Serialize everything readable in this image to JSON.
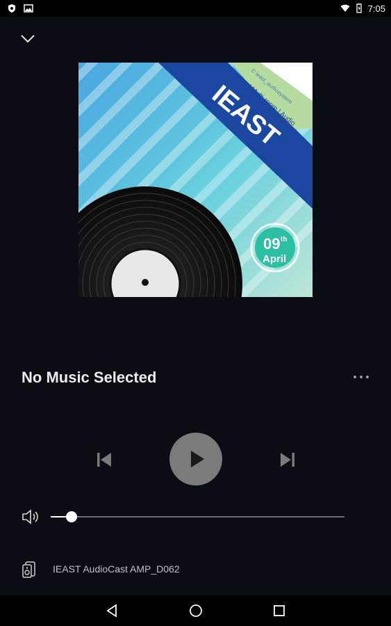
{
  "status_bar": {
    "time": "7:05",
    "left_icons": [
      "shield-icon",
      "image-icon"
    ],
    "right_icons": [
      "wifi-icon",
      "battery-icon"
    ]
  },
  "now_playing": {
    "title": "No Music Selected"
  },
  "album_art": {
    "brand": "IEAST",
    "tagline": "Enjoy | Multi-room | Audio",
    "subline": "© ieast_audiosystem",
    "badge_day": "09",
    "badge_suffix": "th",
    "badge_month": "April",
    "colors": {
      "stripe_light": "#8ee0e6",
      "stripe_blue": "#3cb5d8",
      "band": "#1b47a0",
      "green_band": "#b5dba0",
      "badge": "#2bbfa4"
    }
  },
  "volume": {
    "level": 0.07
  },
  "device": {
    "name": "IEAST AudioCast AMP_D062"
  },
  "nav": {
    "buttons": [
      "back-icon",
      "home-icon",
      "recents-icon"
    ]
  }
}
